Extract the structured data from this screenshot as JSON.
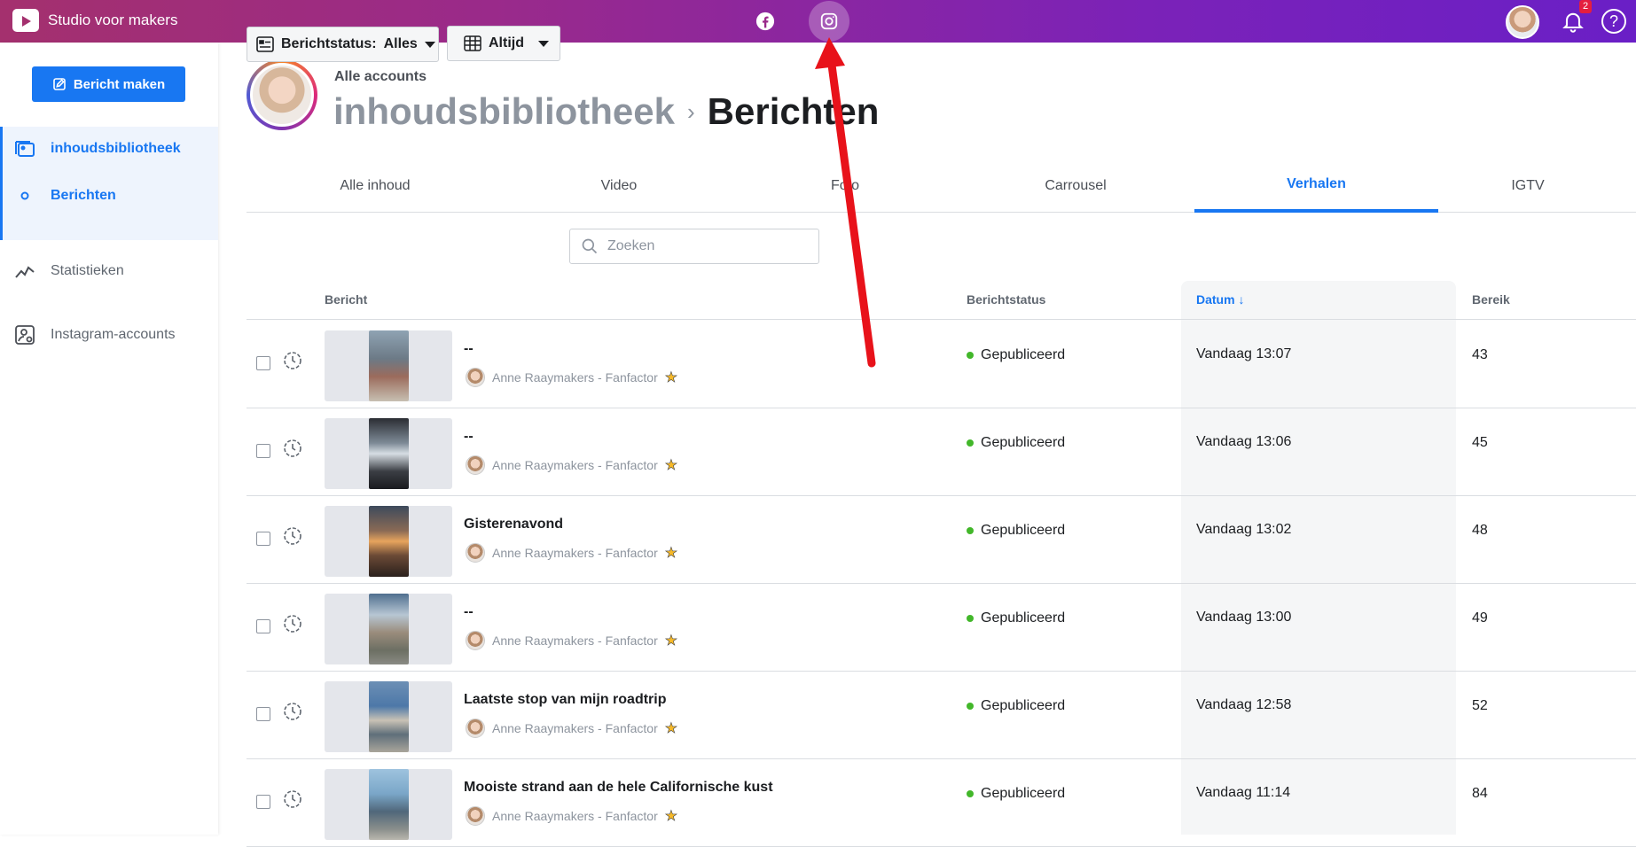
{
  "app": {
    "title": "Studio voor makers"
  },
  "topbar": {
    "notification_count": "2",
    "help": "?"
  },
  "sidebar": {
    "create_button": "Bericht maken",
    "items": [
      {
        "label": "inhoudsbibliotheek"
      },
      {
        "label": "Berichten"
      },
      {
        "label": "Statistieken"
      },
      {
        "label": "Instagram-accounts"
      }
    ]
  },
  "header": {
    "account": "Alle accounts",
    "breadcrumb_parent": "inhoudsbibliotheek",
    "breadcrumb_sep": "›",
    "breadcrumb_current": "Berichten"
  },
  "tabs": [
    "Alle inhoud",
    "Video",
    "Foto",
    "Carrousel",
    "Verhalen",
    "IGTV"
  ],
  "active_tab": "Verhalen",
  "filters": {
    "status_label": "Berichtstatus:",
    "status_value": "Alles",
    "date_value": "Altijd",
    "search_placeholder": "Zoeken"
  },
  "table": {
    "columns": {
      "post": "Bericht",
      "status": "Berichtstatus",
      "date": "Datum ↓",
      "reach": "Bereik"
    },
    "rows": [
      {
        "title": "--",
        "author": "Anne Raaymakers - Fanfactor",
        "status": "Gepubliceerd",
        "date": "Vandaag 13:07",
        "reach": "43"
      },
      {
        "title": "--",
        "author": "Anne Raaymakers - Fanfactor",
        "status": "Gepubliceerd",
        "date": "Vandaag 13:06",
        "reach": "45"
      },
      {
        "title": "Gisterenavond",
        "author": "Anne Raaymakers - Fanfactor",
        "status": "Gepubliceerd",
        "date": "Vandaag 13:02",
        "reach": "48"
      },
      {
        "title": "--",
        "author": "Anne Raaymakers - Fanfactor",
        "status": "Gepubliceerd",
        "date": "Vandaag 13:00",
        "reach": "49"
      },
      {
        "title": "Laatste stop van mijn roadtrip",
        "author": "Anne Raaymakers - Fanfactor",
        "status": "Gepubliceerd",
        "date": "Vandaag 12:58",
        "reach": "52"
      },
      {
        "title": "Mooiste strand aan de hele Californische kust",
        "author": "Anne Raaymakers - Fanfactor",
        "status": "Gepubliceerd",
        "date": "Vandaag 11:14",
        "reach": "84"
      }
    ]
  },
  "colors": {
    "accent": "#1877f2",
    "annotation": "#e8121a",
    "published": "#42b72a"
  }
}
